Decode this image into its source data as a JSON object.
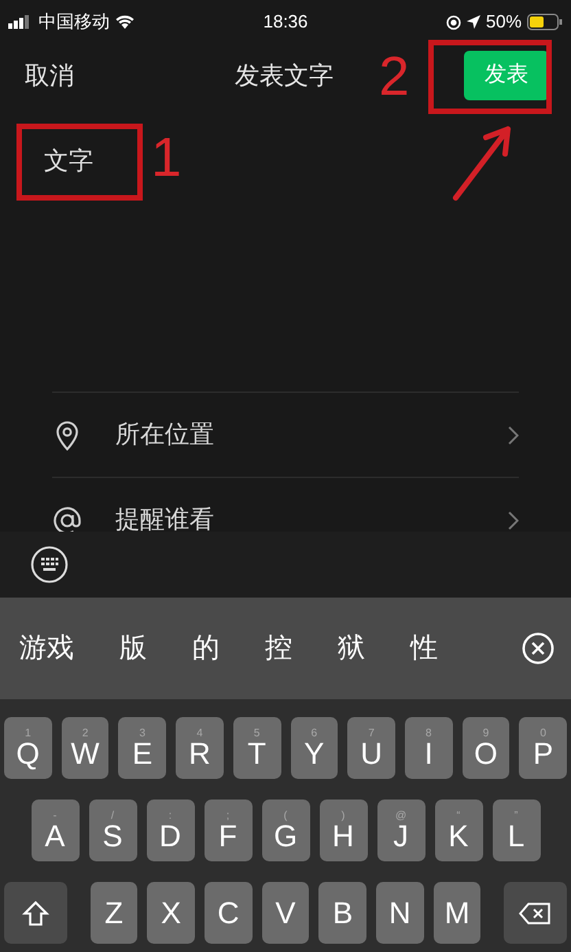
{
  "status_bar": {
    "carrier": "中国移动",
    "time": "18:36",
    "battery": "50%"
  },
  "header": {
    "cancel": "取消",
    "title": "发表文字",
    "publish": "发表"
  },
  "editor": {
    "value": "文字"
  },
  "options": [
    {
      "kind": "location",
      "label": "所在位置"
    },
    {
      "kind": "mention",
      "label": "提醒谁看"
    }
  ],
  "annotations": [
    {
      "label": "1"
    },
    {
      "label": "2"
    }
  ],
  "candidates": [
    "游戏",
    "版",
    "的",
    "控",
    "狱",
    "性"
  ],
  "keyboard": {
    "rows": [
      [
        {
          "key": "Q",
          "hint": "1"
        },
        {
          "key": "W",
          "hint": "2"
        },
        {
          "key": "E",
          "hint": "3"
        },
        {
          "key": "R",
          "hint": "4"
        },
        {
          "key": "T",
          "hint": "5"
        },
        {
          "key": "Y",
          "hint": "6"
        },
        {
          "key": "U",
          "hint": "7"
        },
        {
          "key": "I",
          "hint": "8"
        },
        {
          "key": "O",
          "hint": "9"
        },
        {
          "key": "P",
          "hint": "0"
        }
      ],
      [
        {
          "key": "A",
          "hint": "-"
        },
        {
          "key": "S",
          "hint": "/"
        },
        {
          "key": "D",
          "hint": ":"
        },
        {
          "key": "F",
          "hint": ";"
        },
        {
          "key": "G",
          "hint": "("
        },
        {
          "key": "H",
          "hint": ")"
        },
        {
          "key": "J",
          "hint": "@"
        },
        {
          "key": "K",
          "hint": "“"
        },
        {
          "key": "L",
          "hint": "”"
        }
      ],
      [
        {
          "key": "Z"
        },
        {
          "key": "X"
        },
        {
          "key": "C"
        },
        {
          "key": "V"
        },
        {
          "key": "B"
        },
        {
          "key": "N"
        },
        {
          "key": "M"
        }
      ]
    ]
  }
}
